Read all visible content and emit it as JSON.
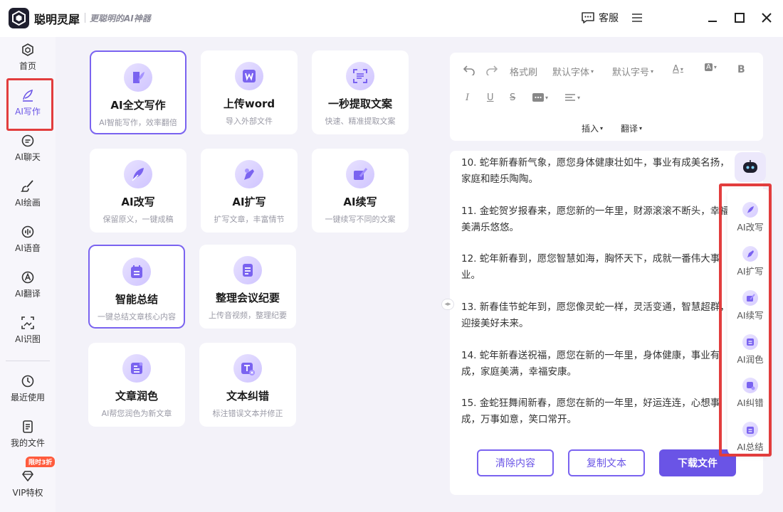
{
  "app": {
    "title": "聪明灵犀",
    "slogan": "更聪明的AI神器",
    "service_label": "客服"
  },
  "sidebar": {
    "items": [
      {
        "label": "首页",
        "icon": "home-icon"
      },
      {
        "label": "AI写作",
        "icon": "pen-icon",
        "active": true
      },
      {
        "label": "AI聊天",
        "icon": "chat-icon"
      },
      {
        "label": "AI绘画",
        "icon": "brush-icon"
      },
      {
        "label": "AI语音",
        "icon": "voice-icon"
      },
      {
        "label": "AI翻译",
        "icon": "translate-icon"
      },
      {
        "label": "AI识图",
        "icon": "image-recognition-icon"
      },
      {
        "label": "最近使用",
        "icon": "history-icon"
      },
      {
        "label": "我的文件",
        "icon": "file-icon"
      },
      {
        "label": "VIP特权",
        "icon": "diamond-icon"
      }
    ],
    "vip_badge": "限时3折"
  },
  "tools": [
    {
      "title": "AI全文写作",
      "desc": "AI智能写作，效率翻倍",
      "selected": true
    },
    {
      "title": "上传word",
      "desc": "导入外部文件"
    },
    {
      "title": "一秒提取文案",
      "desc": "快速、精准提取文案"
    },
    {
      "title": "AI改写",
      "desc": "保留原义，一键成稿"
    },
    {
      "title": "AI扩写",
      "desc": "扩写文章，丰富情节"
    },
    {
      "title": "AI续写",
      "desc": "一键续写不同的文案"
    },
    {
      "title": "智能总结",
      "desc": "一键总结文章核心内容",
      "selected": true
    },
    {
      "title": "整理会议纪要",
      "desc": "上传音视频，整理纪要"
    },
    {
      "title": "文章润色",
      "desc": "AI帮您润色为新文章"
    },
    {
      "title": "文本纠错",
      "desc": "标注错误文本并修正"
    }
  ],
  "toolbar": {
    "format_brush": "格式刷",
    "default_font": "默认字体",
    "default_size": "默认字号",
    "insert": "插入",
    "translate": "翻译",
    "font_color_glyph": "A",
    "highlight_glyph": "A",
    "bold_glyph": "B",
    "italic_glyph": "I",
    "underline_glyph": "U",
    "strike_glyph": "S"
  },
  "content": [
    "10. 蛇年新春新气象，愿您身体健康壮如牛，事业有成美名扬，家庭和睦乐陶陶。",
    "11. 金蛇贺岁报春来，愿您新的一年里，财源滚滚不断头，幸福美满乐悠悠。",
    "12. 蛇年新春到，愿您智慧如海，胸怀天下，成就一番伟大事业。",
    "13. 新春佳节蛇年到，愿您像灵蛇一样，灵活变通，智慧超群，迎接美好未来。",
    "14. 蛇年新春送祝福，愿您在新的一年里，身体健康，事业有成，家庭美满，幸福安康。",
    "15. 金蛇狂舞闹新春，愿您在新的一年里，好运连连，心想事成，万事如意，笑口常开。"
  ],
  "actions": {
    "clear": "清除内容",
    "copy": "复制文本",
    "download": "下载文件"
  },
  "quick_tools": [
    {
      "label": "AI改写",
      "icon": "feather-icon"
    },
    {
      "label": "AI扩写",
      "icon": "expand-pen-icon"
    },
    {
      "label": "AI续写",
      "icon": "continue-icon"
    },
    {
      "label": "AI润色",
      "icon": "polish-icon"
    },
    {
      "label": "AI纠错",
      "icon": "correct-icon"
    },
    {
      "label": "AI总结",
      "icon": "summary-icon"
    }
  ],
  "colors": {
    "accent": "#6a54e6",
    "highlight_box": "#e23d3d"
  }
}
